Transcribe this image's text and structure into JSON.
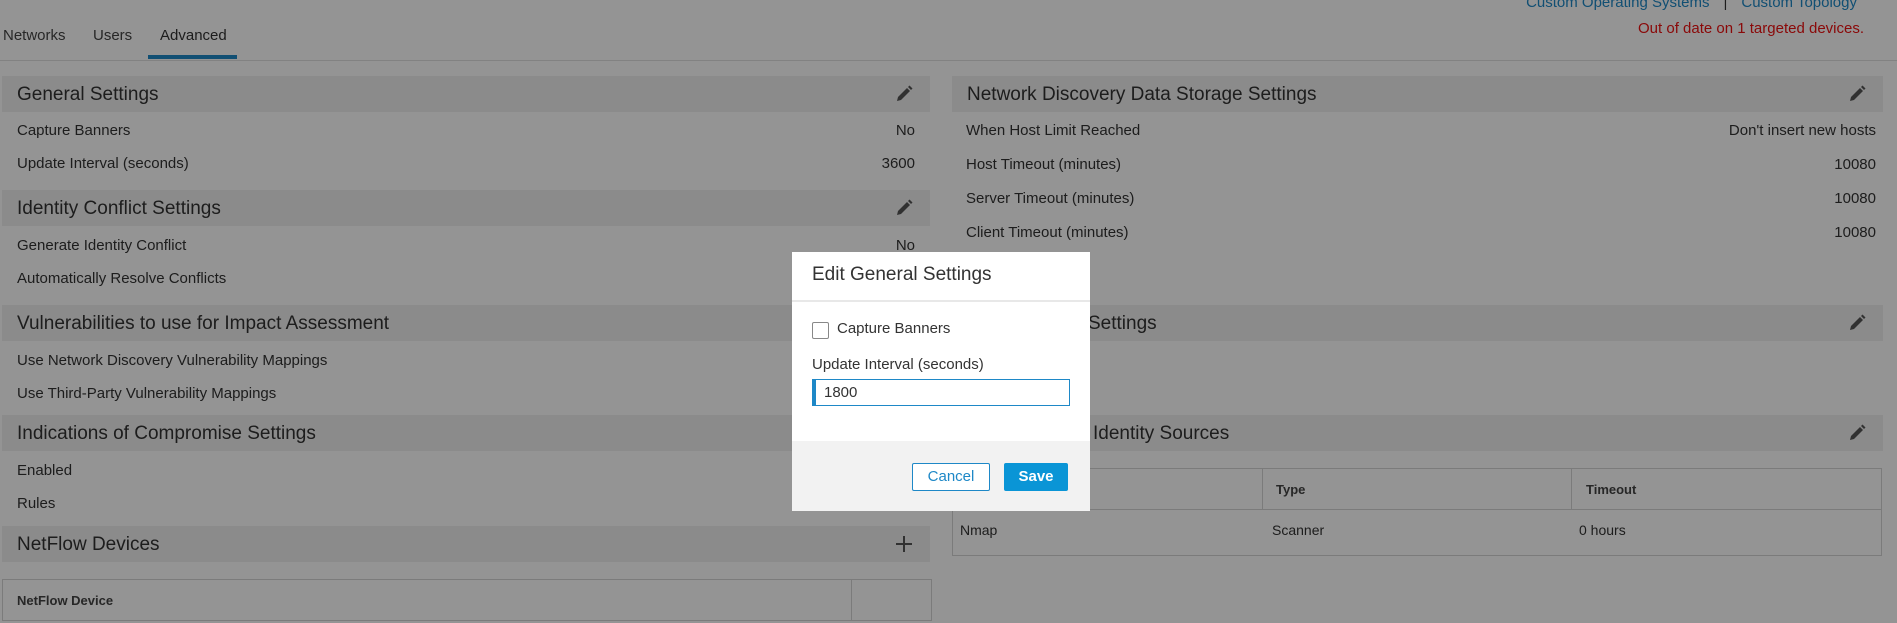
{
  "tabs": [
    {
      "label": "Networks"
    },
    {
      "label": "Users"
    },
    {
      "label": "Advanced",
      "active": true
    }
  ],
  "top_links": {
    "custom_os": "Custom Operating Systems",
    "separator": "|",
    "custom_topology": "Custom Topology"
  },
  "status": {
    "out_of_date": "Out of date on 1 targeted devices."
  },
  "left_sections": {
    "general": {
      "title": "General Settings",
      "rows": [
        {
          "label": "Capture Banners",
          "value": "No"
        },
        {
          "label": "Update Interval (seconds)",
          "value": "3600"
        }
      ]
    },
    "identity_conflict": {
      "title": "Identity Conflict Settings",
      "rows": [
        {
          "label": "Generate Identity Conflict",
          "value": "No"
        },
        {
          "label": "Automatically Resolve Conflicts",
          "value": ""
        }
      ]
    },
    "vulnerabilities": {
      "title": "Vulnerabilities to use for Impact Assessment",
      "rows": [
        {
          "label": "Use Network Discovery Vulnerability Mappings"
        },
        {
          "label": "Use Third-Party Vulnerability Mappings"
        }
      ]
    },
    "ioc": {
      "title": "Indications of Compromise Settings",
      "rows": [
        {
          "label": "Enabled"
        },
        {
          "label": "Rules"
        }
      ]
    },
    "netflow": {
      "title": "NetFlow Devices",
      "table_header": "NetFlow Device"
    }
  },
  "right_sections": {
    "storage": {
      "title": "Network Discovery Data Storage Settings",
      "rows": [
        {
          "label": "When Host Limit Reached",
          "value": "Don't insert new hosts"
        },
        {
          "label": "Host Timeout (minutes)",
          "value": "10080"
        },
        {
          "label": "Server Timeout (minutes)",
          "value": "10080"
        },
        {
          "label": "Client Timeout (minutes)",
          "value": "10080"
        }
      ]
    },
    "partial_settings": {
      "title": "Settings"
    },
    "identity_sources": {
      "title": "Identity Sources",
      "columns": [
        "Type",
        "Timeout"
      ],
      "rows": [
        {
          "name": "Nmap",
          "type": "Scanner",
          "timeout": "0 hours"
        }
      ]
    }
  },
  "modal": {
    "title": "Edit General Settings",
    "capture_banners_label": "Capture Banners",
    "capture_banners_checked": false,
    "update_interval_label": "Update Interval (seconds)",
    "update_interval_value": "1800",
    "cancel_label": "Cancel",
    "save_label": "Save"
  },
  "icons": {
    "edit": "pencil-icon",
    "add": "plus-icon"
  },
  "colors": {
    "accent": "#1e88c7",
    "alert": "#ee1111",
    "save_button": "#0a95d6"
  }
}
